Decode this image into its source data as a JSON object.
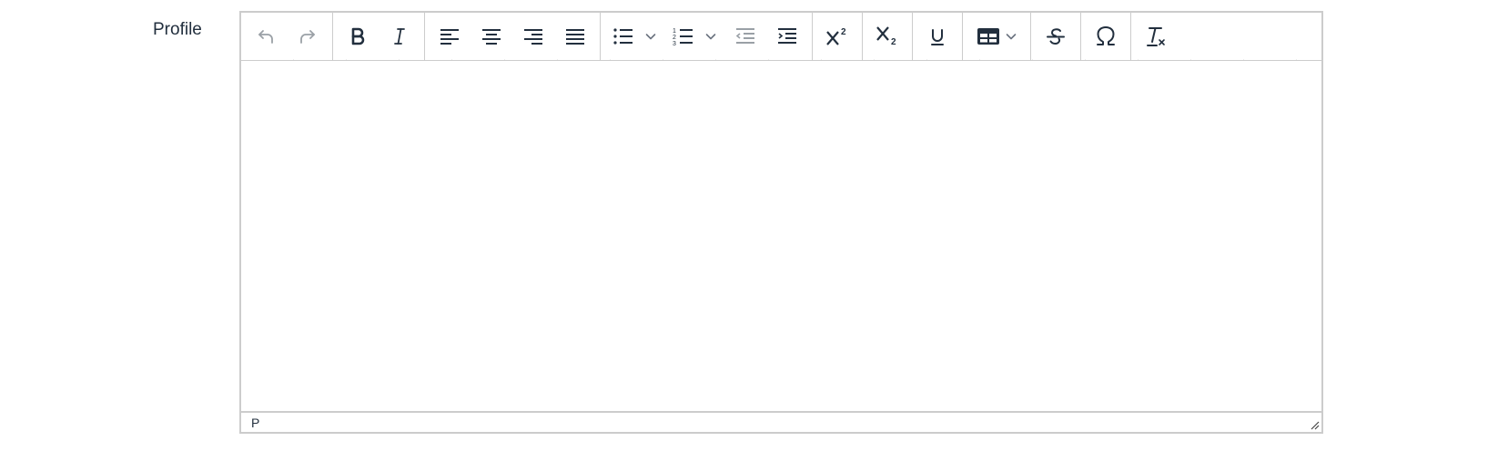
{
  "form": {
    "label": "Profile"
  },
  "editor": {
    "statusbar_path": "P",
    "toolbar": {
      "undo": "undo-icon",
      "redo": "redo-icon",
      "bold": "bold-icon",
      "italic": "italic-icon",
      "align_left": "align-left-icon",
      "align_center": "align-center-icon",
      "align_right": "align-right-icon",
      "align_justify": "align-justify-icon",
      "bullet_list": "bullet-list-icon",
      "numbered_list": "numbered-list-icon",
      "outdent": "outdent-icon",
      "indent": "indent-icon",
      "superscript": "superscript-icon",
      "subscript": "subscript-icon",
      "underline": "underline-icon",
      "table": "table-icon",
      "strikethrough": "strikethrough-icon",
      "special_char": "omega-icon",
      "clear_format": "clear-formatting-icon"
    },
    "colors": {
      "icon": "#222f3e",
      "icon_disabled": "#9aa0a6",
      "border": "#cccccc"
    }
  }
}
